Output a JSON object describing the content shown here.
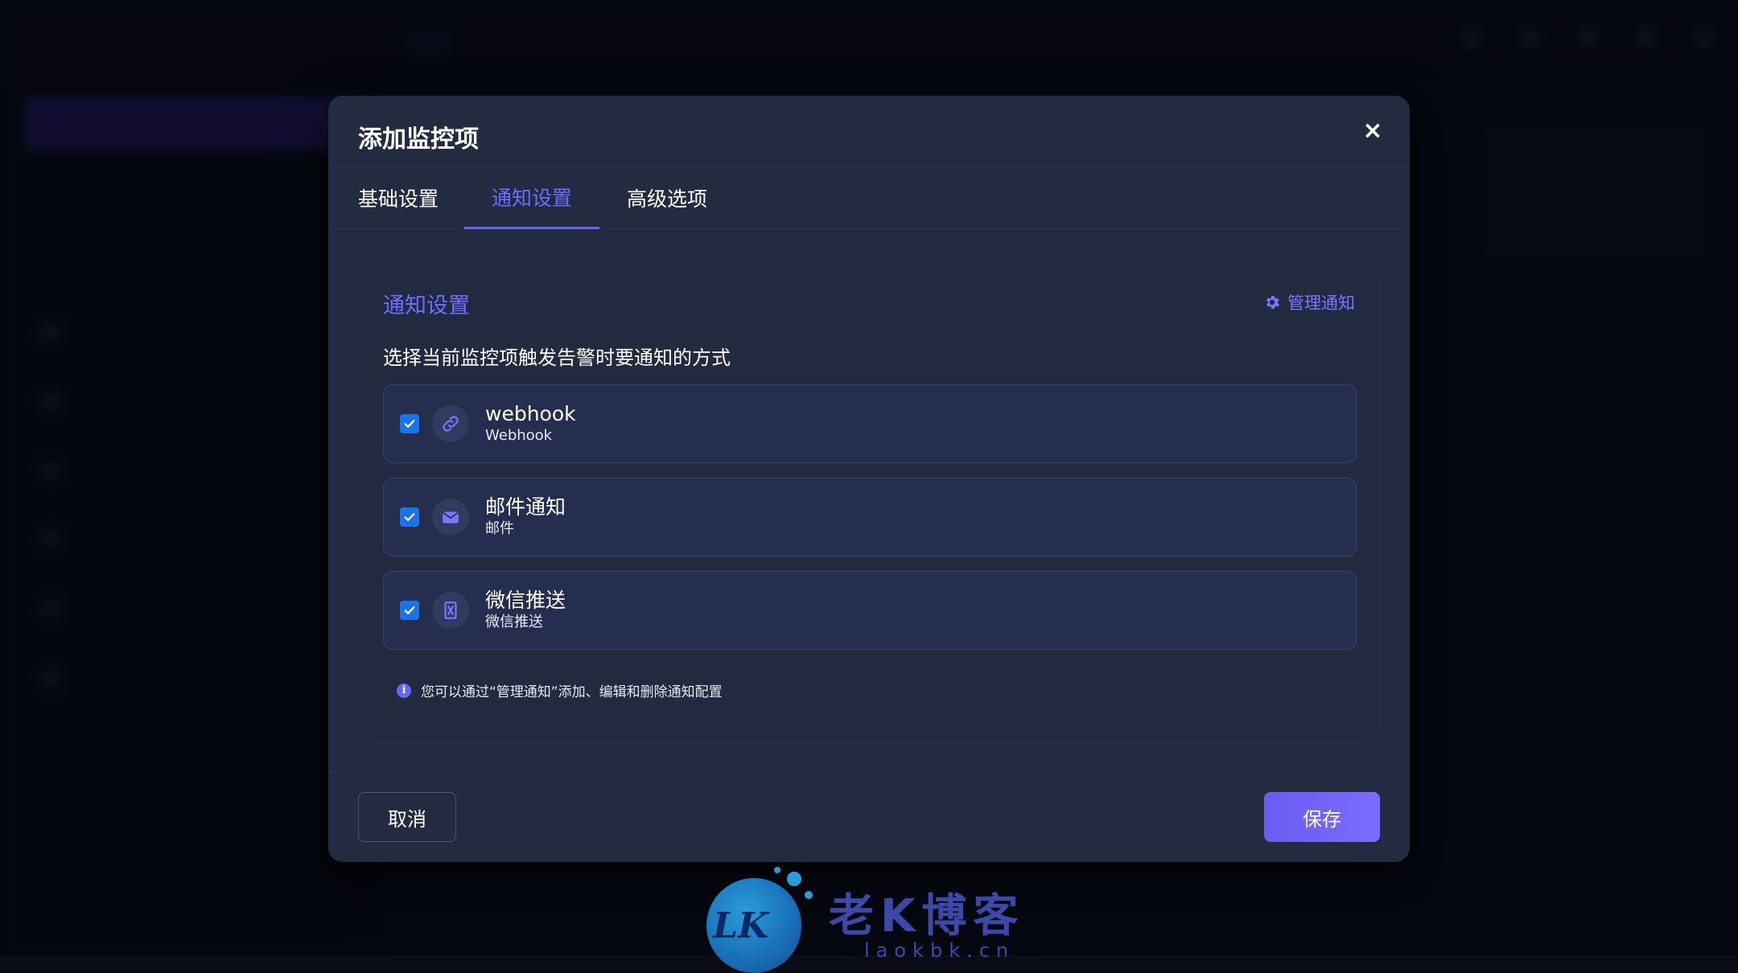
{
  "modal": {
    "title": "添加监控项",
    "close_label": "×",
    "tabs": [
      {
        "label": "基础设置",
        "active": false
      },
      {
        "label": "通知设置",
        "active": true
      },
      {
        "label": "高级选项",
        "active": false
      }
    ],
    "panel": {
      "title": "通知设置",
      "manage_label": "管理通知",
      "description": "选择当前监控项触发告警时要通知的方式",
      "channels": [
        {
          "name": "webhook",
          "type": "Webhook",
          "checked": true,
          "icon": "link-icon"
        },
        {
          "name": "邮件通知",
          "type": "邮件",
          "checked": true,
          "icon": "envelope-icon"
        },
        {
          "name": "微信推送",
          "type": "微信推送",
          "checked": true,
          "icon": "wechat-icon"
        }
      ],
      "hint": "您可以通过“管理通知”添加、编辑和删除通知配置"
    },
    "footer": {
      "cancel_label": "取消",
      "save_label": "保存"
    }
  },
  "watermark": {
    "logo_text": "LK",
    "name": "老K博客",
    "url": "laokbk.cn"
  },
  "colors": {
    "accent": "#6a64f5",
    "modal_bg": "#222b40",
    "checkbox": "#1a73e8"
  }
}
